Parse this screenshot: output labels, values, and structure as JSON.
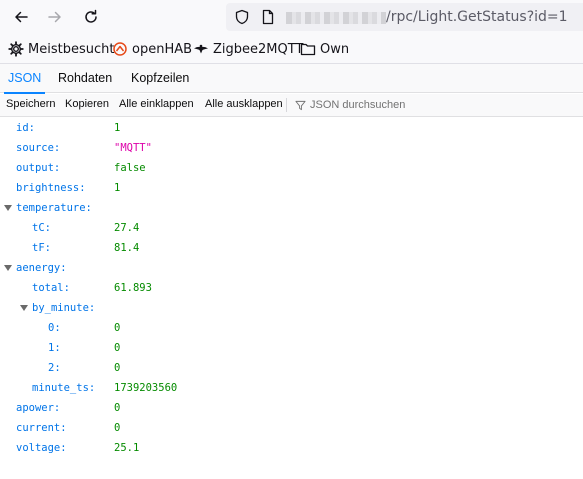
{
  "nav": {
    "url_path": "/rpc/Light.GetStatus?id=1"
  },
  "bookmarks": [
    {
      "label": "Meistbesucht",
      "icon": "gear-icon"
    },
    {
      "label": "openHAB",
      "icon": "openhab-icon"
    },
    {
      "label": "Zigbee2MQTT",
      "icon": "zigbee-bee-icon"
    },
    {
      "label": "Own",
      "icon": "folder-icon"
    }
  ],
  "tabs": [
    {
      "label": "JSON",
      "active": true
    },
    {
      "label": "Rohdaten",
      "active": false
    },
    {
      "label": "Kopfzeilen",
      "active": false
    }
  ],
  "toolbar": {
    "save": "Speichern",
    "copy": "Kopieren",
    "collapse_all": "Alle einklappen",
    "expand_all": "Alle ausklappen",
    "filter_placeholder": "JSON durchsuchen"
  },
  "json_rows": [
    {
      "key": "id:",
      "value": "1",
      "type": "num"
    },
    {
      "key": "source:",
      "value": "\"MQTT\"",
      "type": "str"
    },
    {
      "key": "output:",
      "value": "false",
      "type": "bool"
    },
    {
      "key": "brightness:",
      "value": "1",
      "type": "num"
    },
    {
      "key": "temperature:",
      "value": "",
      "type": "obj"
    },
    {
      "key": "tC:",
      "value": "27.4",
      "type": "num"
    },
    {
      "key": "tF:",
      "value": "81.4",
      "type": "num"
    },
    {
      "key": "aenergy:",
      "value": "",
      "type": "obj"
    },
    {
      "key": "total:",
      "value": "61.893",
      "type": "num"
    },
    {
      "key": "by_minute:",
      "value": "",
      "type": "obj"
    },
    {
      "key": "0:",
      "value": "0",
      "type": "num"
    },
    {
      "key": "1:",
      "value": "0",
      "type": "num"
    },
    {
      "key": "2:",
      "value": "0",
      "type": "num"
    },
    {
      "key": "minute_ts:",
      "value": "1739203560",
      "type": "num"
    },
    {
      "key": "apower:",
      "value": "0",
      "type": "num"
    },
    {
      "key": "current:",
      "value": "0",
      "type": "num"
    },
    {
      "key": "voltage:",
      "value": "25.1",
      "type": "num"
    }
  ]
}
